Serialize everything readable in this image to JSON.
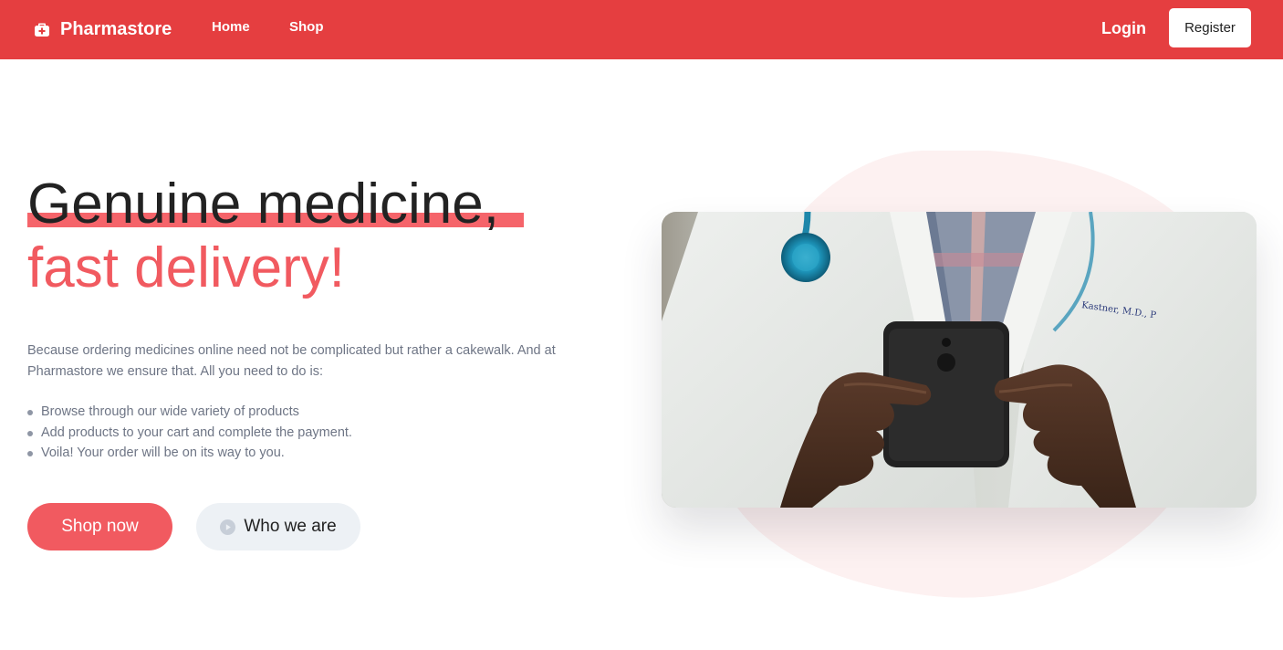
{
  "navbar": {
    "brand": "Pharmastore",
    "links": [
      {
        "label": "Home"
      },
      {
        "label": "Shop"
      }
    ],
    "login_label": "Login",
    "register_label": "Register",
    "background_color": "#e53e40"
  },
  "hero": {
    "headline_line1": "Genuine medicine,",
    "headline_line2": "fast delivery!",
    "intro": "Because ordering medicines online need not be complicated but rather a cakewalk. And at Pharmastore we ensure that. All you need to do is:",
    "steps": [
      "Browse through our wide variety of products",
      "Add products to your cart and complete the payment.",
      "Voila! Your order will be on its way to you."
    ],
    "primary_button": "Shop now",
    "secondary_button": "Who we are",
    "accent_color": "#f15a60",
    "image": {
      "description_icon": "doctor-with-phone-photo",
      "coat_text": "Kastner, M.D., P"
    }
  }
}
